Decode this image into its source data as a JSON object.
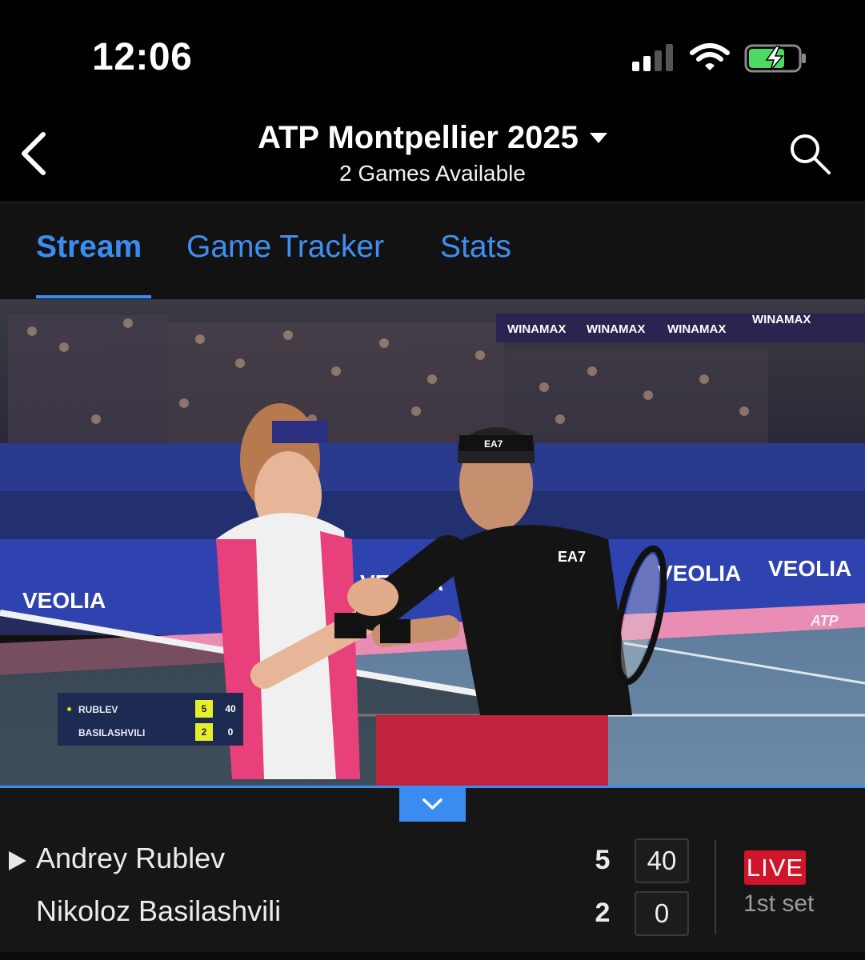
{
  "status_bar": {
    "time": "12:06",
    "signal_icon": "cellular-signal-icon",
    "wifi_icon": "wifi-icon",
    "battery_icon": "battery-charging-icon"
  },
  "header": {
    "title": "ATP Montpellier 2025",
    "subtitle": "2 Games Available",
    "back_icon": "chevron-left-icon",
    "dropdown_icon": "caret-down-icon",
    "search_icon": "search-icon"
  },
  "tabs": [
    {
      "label": "Stream",
      "active": true
    },
    {
      "label": "Game Tracker",
      "active": false
    },
    {
      "label": "Stats",
      "active": false
    }
  ],
  "video": {
    "watermark": "ATP",
    "scoreboard": [
      {
        "name": "RUBLEV",
        "games": "5",
        "points": "40",
        "serving": true
      },
      {
        "name": "BASILASHVILI",
        "games": "2",
        "points": "0",
        "serving": false
      }
    ],
    "signage": [
      "WINAMAX",
      "WINAMAX",
      "WINAMAX",
      "WINAMAX",
      "VEOLIA",
      "VEOLIA",
      "VEOLIA",
      "VEOLIA"
    ],
    "shirt_logo": "EA7"
  },
  "match": {
    "players": [
      {
        "name": "Andrey Rublev",
        "games": "5",
        "points": "40",
        "serving": true
      },
      {
        "name": "Nikoloz Basilashvili",
        "games": "2",
        "points": "0",
        "serving": false
      }
    ],
    "status": "LIVE",
    "set_label": "1st set",
    "collapse_icon": "chevron-down-icon",
    "serve_icon": "play-triangle-icon"
  },
  "colors": {
    "accent": "#3a8cf0",
    "live": "#d0142a",
    "background": "#000000"
  }
}
